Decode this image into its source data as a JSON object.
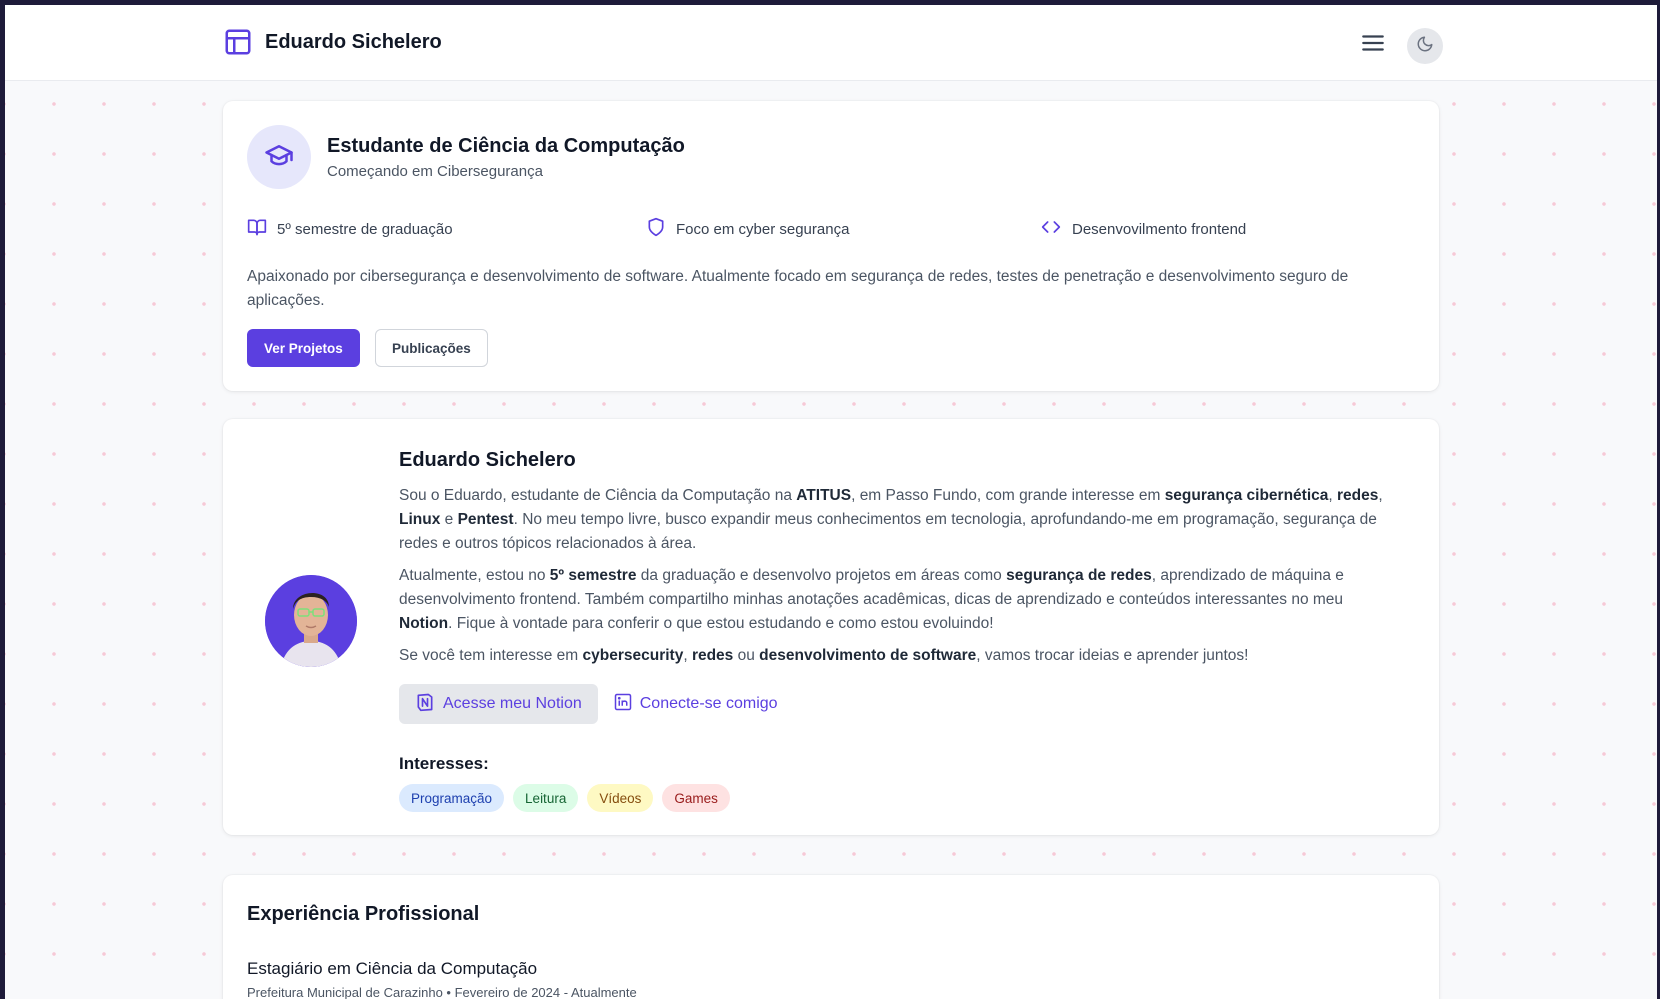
{
  "header": {
    "brand": "Eduardo Sichelero"
  },
  "hero": {
    "title": "Estudante de Ciência da Computação",
    "subtitle": "Começando em Cibersegurança",
    "features": [
      {
        "icon": "book-open-icon",
        "text": "5º semestre de graduação"
      },
      {
        "icon": "shield-icon",
        "text": "Foco em cyber segurança"
      },
      {
        "icon": "code-icon",
        "text": "Desenvovilmento frontend"
      }
    ],
    "description": "Apaixonado por cibersegurança e desenvolvimento de software. Atualmente focado em segurança de redes, testes de penetração e desenvolvimento seguro de aplicações.",
    "primary_button": "Ver Projetos",
    "secondary_button": "Publicações"
  },
  "about": {
    "name": "Eduardo Sichelero",
    "p1": {
      "t1": "Sou o Eduardo, estudante de Ciência da Computação na ",
      "b1": "ATITUS",
      "t2": ", em Passo Fundo, com grande interesse em ",
      "b2": "segurança cibernética",
      "t3": ", ",
      "b3": "redes",
      "t4": ", ",
      "b4": "Linux",
      "t5": " e ",
      "b5": "Pentest",
      "t6": ". No meu tempo livre, busco expandir meus conhecimentos em tecnologia, aprofundando-me em programação, segurança de redes e outros tópicos relacionados à área."
    },
    "p2": {
      "t1": "Atualmente, estou no ",
      "b1": "5º semestre",
      "t2": " da graduação e desenvolvo projetos em áreas como ",
      "b2": "segurança de redes",
      "t3": ", aprendizado de máquina e desenvolvimento frontend. Também compartilho minhas anotações acadêmicas, dicas de aprendizado e conteúdos interessantes no meu ",
      "b3": "Notion",
      "t4": ". Fique à vontade para conferir o que estou estudando e como estou evoluindo!"
    },
    "p3": {
      "t1": "Se você tem interesse em ",
      "b1": "cybersecurity",
      "t2": ", ",
      "b2": "redes",
      "t3": " ou ",
      "b3": "desenvolvimento de software",
      "t4": ", vamos trocar ideias e aprender juntos!"
    },
    "notion_button": "Acesse meu Notion",
    "linkedin_link": "Conecte-se comigo",
    "interests_title": "Interesses:",
    "interests": [
      {
        "label": "Programação",
        "bg": "#dbeafe",
        "fg": "#1e40af"
      },
      {
        "label": "Leitura",
        "bg": "#dcfce7",
        "fg": "#166534"
      },
      {
        "label": "Vídeos",
        "bg": "#fef9c3",
        "fg": "#854d0e"
      },
      {
        "label": "Games",
        "bg": "#fee2e2",
        "fg": "#991b1b"
      }
    ]
  },
  "experience": {
    "title": "Experiência Profissional",
    "jobs": [
      {
        "title": "Estagiário em Ciência da Computação",
        "meta": "Prefeitura Municipal de Carazinho • Fevereiro de 2024 - Atualmente"
      }
    ]
  },
  "colors": {
    "accent": "#5b3fe0",
    "background": "#f8f9fb",
    "dots": "#f6c9d6"
  }
}
